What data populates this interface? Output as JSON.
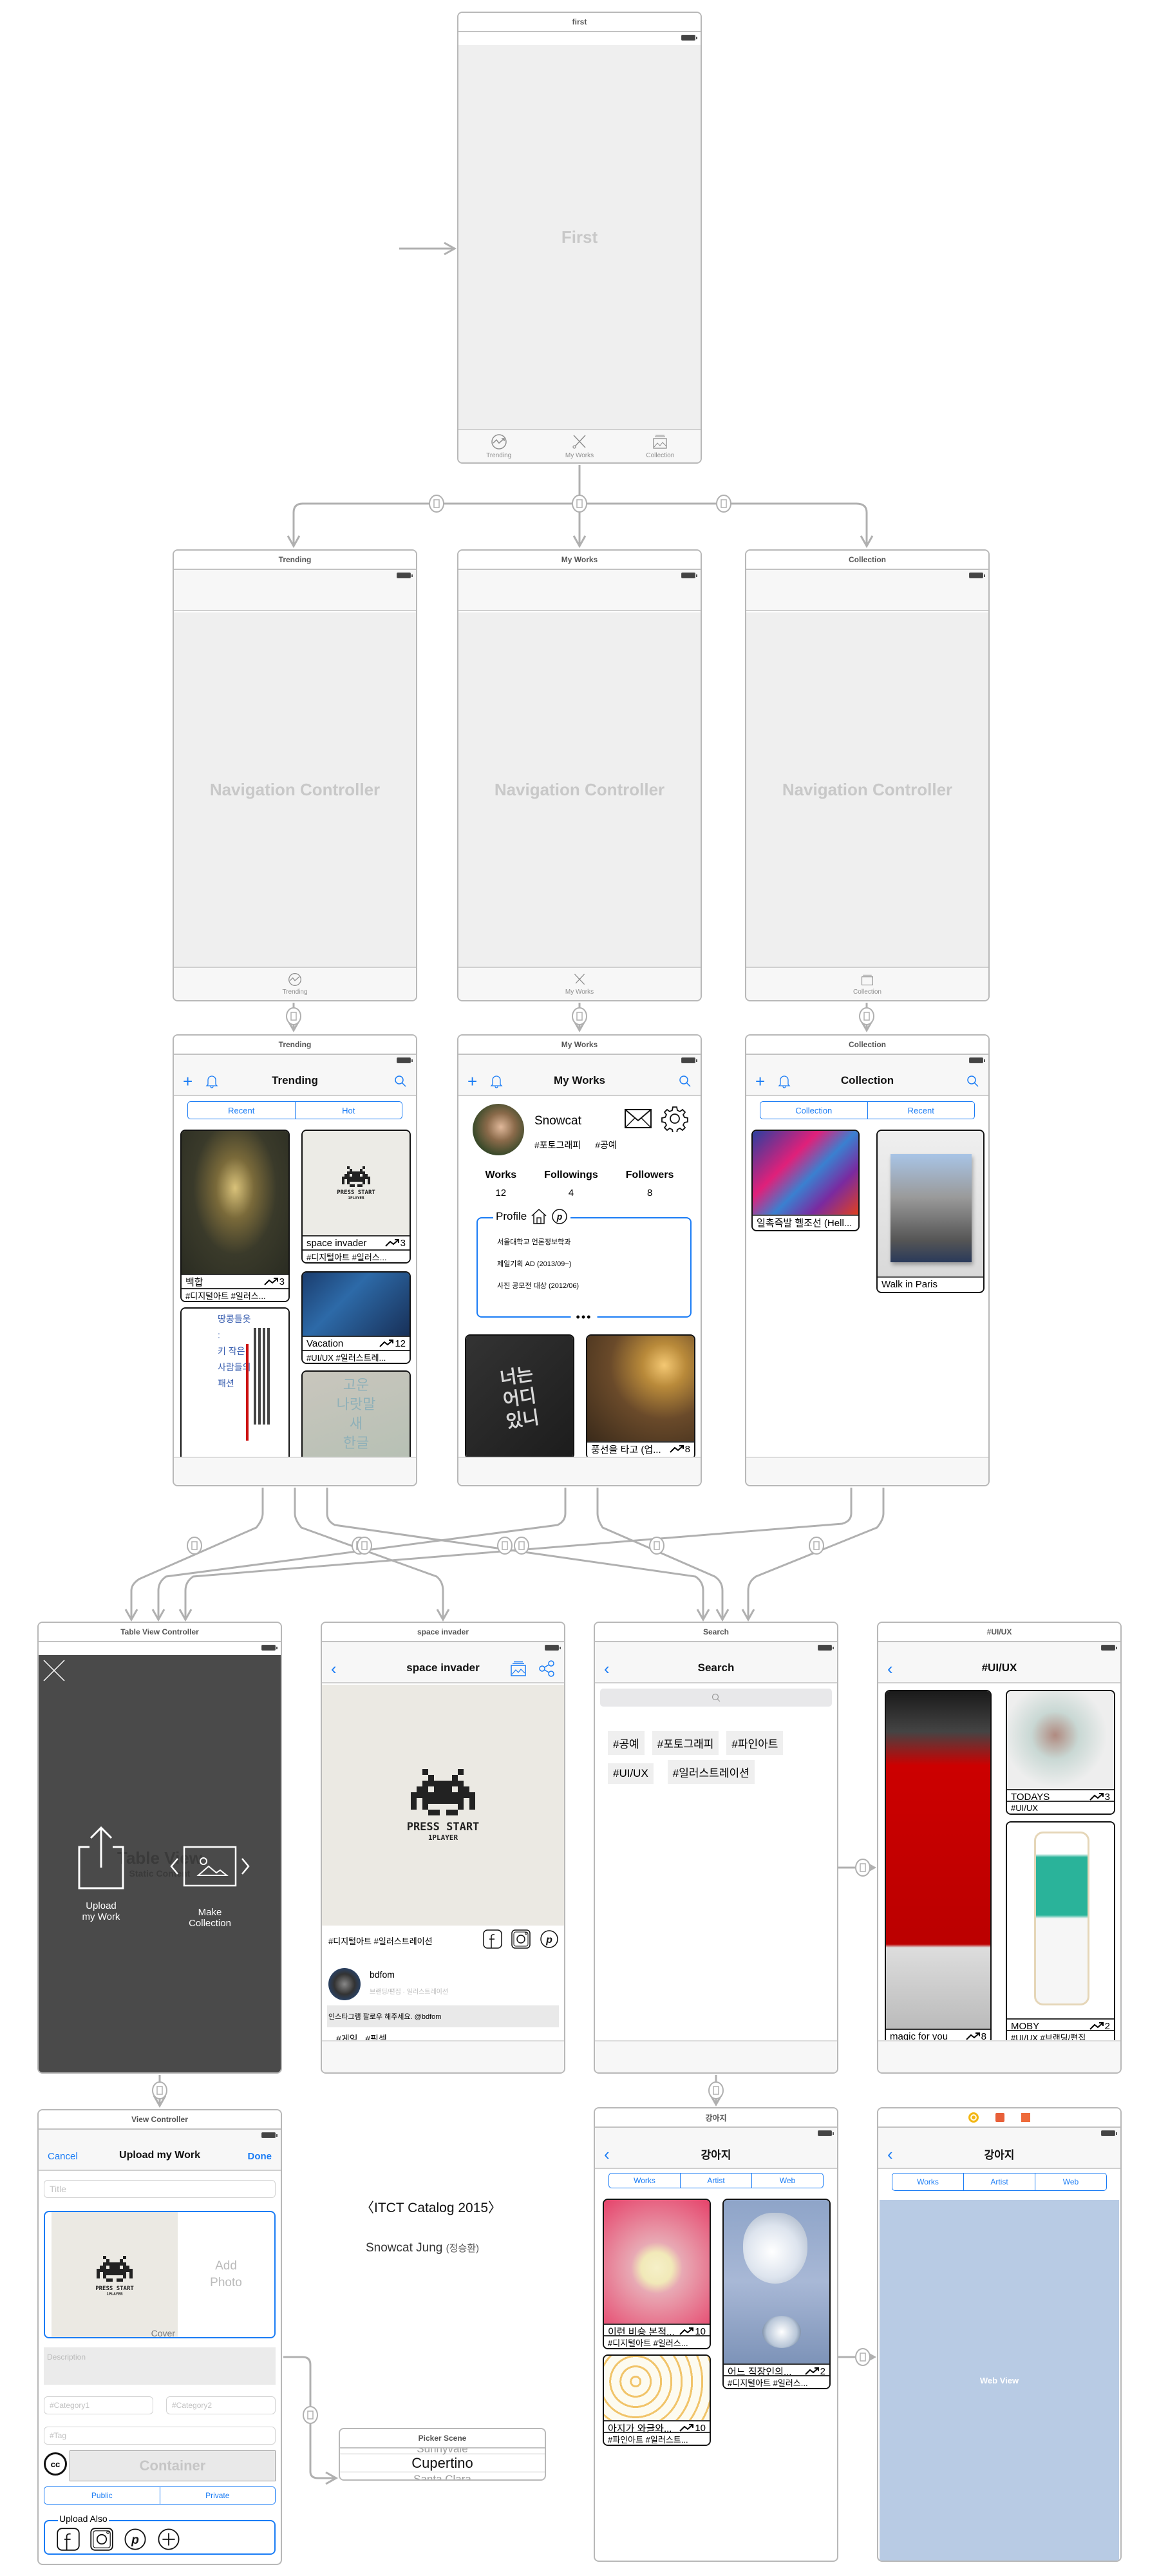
{
  "storyboard": {
    "first": {
      "scene_title": "first",
      "placeholder": "First",
      "tabs": [
        {
          "label": "Trending",
          "icon": "trending-icon"
        },
        {
          "label": "My Works",
          "icon": "pencil-brush-icon"
        },
        {
          "label": "Collection",
          "icon": "photo-stack-icon"
        }
      ]
    },
    "nav_controllers": [
      {
        "scene_title": "Trending",
        "placeholder": "Navigation Controller",
        "tab_label": "Trending"
      },
      {
        "scene_title": "My Works",
        "placeholder": "Navigation Controller",
        "tab_label": "My Works"
      },
      {
        "scene_title": "Collection",
        "placeholder": "Navigation Controller",
        "tab_label": "Collection"
      }
    ],
    "trending": {
      "scene_title": "Trending",
      "nav_title": "Trending",
      "segments": [
        "Recent",
        "Hot"
      ],
      "cards": [
        {
          "title": "백합",
          "trend": "3",
          "tags": "#디지털아트  #일러스..."
        },
        {
          "title": "space invader",
          "trend": "3",
          "tags": "#디지털아트  #일러스..."
        },
        {
          "title": "Vacation",
          "trend": "12",
          "tags": "#UI/UX  #일러스트레..."
        },
        {
          "poster_text": [
            "땅콩들옷",
            ":",
            "키 작은",
            "사람들의",
            "패션"
          ]
        },
        {
          "poster_text": [
            "고운",
            "나랏말",
            "새",
            "한글"
          ]
        }
      ]
    },
    "my_works": {
      "scene_title": "My Works",
      "nav_title": "My Works",
      "profile_name": "Snowcat",
      "profile_tags": [
        "#포토그래피",
        "#공예"
      ],
      "stats": [
        {
          "label": "Works",
          "value": "12"
        },
        {
          "label": "Followings",
          "value": "4"
        },
        {
          "label": "Followers",
          "value": "8"
        }
      ],
      "profile_box_title": "Profile",
      "profile_lines": [
        "서울대학교 언론정보학과",
        "제일기획  AD (2013/09~)",
        "사진 공모전 대상 (2012/06)"
      ],
      "more": "•••",
      "cards": [
        {
          "title": "",
          "poster_text": "너는 어디 있니"
        },
        {
          "title": "풍선을 타고 (업...",
          "trend": "8"
        }
      ]
    },
    "collection": {
      "scene_title": "Collection",
      "nav_title": "Collection",
      "segments": [
        "Collection",
        "Recent"
      ],
      "cards": [
        {
          "title": "일촉즉발 헬조선 (Hell..."
        },
        {
          "title": "Walk in Paris"
        }
      ]
    },
    "table_view": {
      "scene_title": "Table View Controller",
      "ghost_title": "Table View",
      "ghost_subtitle": "Static Content",
      "actions": [
        {
          "label_line1": "Upload",
          "label_line2": "my Work"
        },
        {
          "label_line1": "Make",
          "label_line2": "Collection"
        }
      ]
    },
    "space_invader": {
      "scene_title": "space invader",
      "nav_title": "space invader",
      "art_line1": "PRESS START",
      "art_line2": "1PLAYER",
      "tags": "#디지털아트  #일러스트레이션",
      "artist_name": "bdfom",
      "artist_fields": "브랜딩/편집 · 일러스트레이션",
      "comment": "인스타그램 팔로우 해주세요. @bdfom",
      "work_tags": "#게임   #픽셀"
    },
    "search": {
      "scene_title": "Search",
      "nav_title": "Search",
      "search_placeholder": "",
      "hashtags": [
        "#공예",
        "#포토그래피",
        "#파인아트",
        "#UI/UX",
        "#일러스트레이션"
      ]
    },
    "uiux": {
      "scene_title": "#UI/UX",
      "nav_title": "#UI/UX",
      "cards": [
        {
          "title": "magic for you",
          "trend": "8"
        },
        {
          "title": "TODAYS",
          "trend": "3",
          "tags": "#UI/UX"
        },
        {
          "title": "MOBY",
          "trend": "2",
          "tags": "#UI/UX  #브랜딩/편집"
        }
      ]
    },
    "upload": {
      "scene_title": "View Controller",
      "cancel": "Cancel",
      "nav_title": "Upload my Work",
      "done": "Done",
      "title_placeholder": "Title",
      "cover_label": "Cover",
      "add_photo_line1": "Add",
      "add_photo_line2": "Photo",
      "art_line1": "PRESS START",
      "art_line2": "1PLAYER",
      "description_placeholder": "Description",
      "category1_placeholder": "#Category1",
      "category2_placeholder": "#Category2",
      "tag_placeholder": "#Tag",
      "license_icon": "cc",
      "container_label": "Container",
      "visibility_segments": [
        "Public",
        "Private"
      ],
      "upload_also_title": "Upload Also"
    },
    "catalog": {
      "title": "〈ITCT Catalog 2015〉",
      "author": "Snowcat Jung",
      "author_korean": "(정승환)"
    },
    "picker": {
      "scene_title": "Picker Scene",
      "prev": "Sunnyvale",
      "selected": "Cupertino",
      "next": "Santa Clara"
    },
    "dog": {
      "scene_title": "강아지",
      "nav_title": "강아지",
      "segments": [
        "Works",
        "Artist",
        "Web"
      ],
      "cards": [
        {
          "title": "이런 비숑 본적...",
          "trend": "10",
          "tags": "#디지털아트  #일러스..."
        },
        {
          "title": "어느 직장인의...",
          "trend": "2",
          "tags": "#디지털아트  #일러스..."
        },
        {
          "title": "아지가 와글와...",
          "trend": "10",
          "tags": "#파인아트  #일러스트..."
        }
      ]
    },
    "dog_web": {
      "nav_title": "강아지",
      "segments": [
        "Works",
        "Artist",
        "Web"
      ],
      "web_view_label": "Web View"
    }
  },
  "colors": {
    "accent": "#1a7cf5",
    "scene_border": "#b8b8b8",
    "segue_line": "#b0b0b0",
    "dark_overlay": "#4a4a4a",
    "web_view": "#b8cbe4"
  }
}
